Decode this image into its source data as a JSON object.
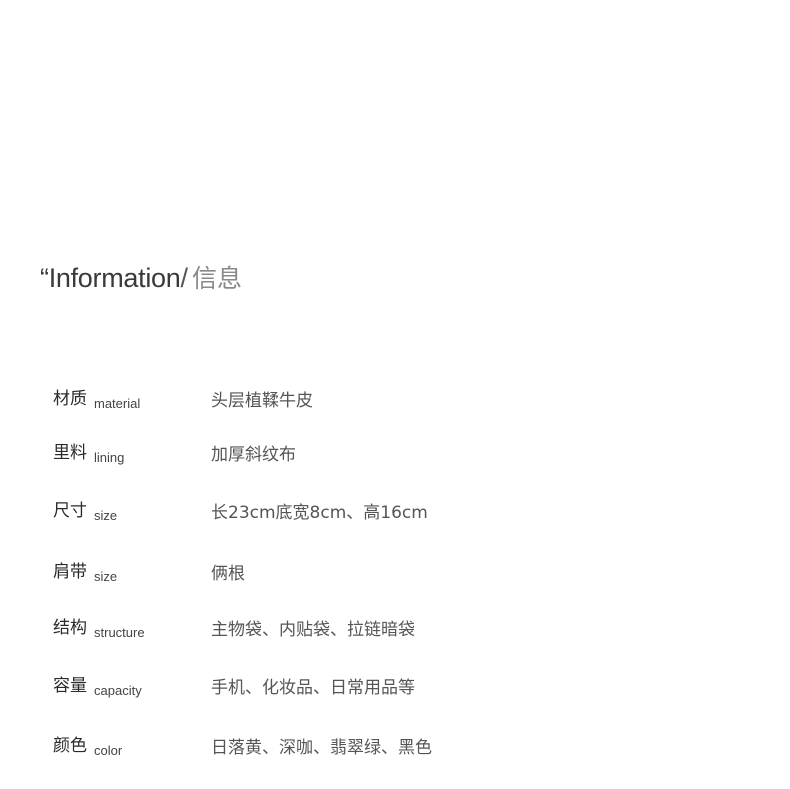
{
  "heading": {
    "english": "“Information",
    "separator": "/",
    "chinese": "信息"
  },
  "specs": [
    {
      "label_cn": "材质",
      "label_en": "material",
      "value": "头层植鞣牛皮"
    },
    {
      "label_cn": "里料",
      "label_en": "lining",
      "value": "加厚斜纹布"
    },
    {
      "label_cn": "尺寸",
      "label_en": "size",
      "value": "长23cm底宽8cm、高16cm"
    },
    {
      "label_cn": "肩带",
      "label_en": "size",
      "value": "俩根"
    },
    {
      "label_cn": "结构",
      "label_en": "structure",
      "value": "主物袋、内贴袋、拉链暗袋"
    },
    {
      "label_cn": "容量",
      "label_en": "capacity",
      "value": "手机、化妆品、日常用品等"
    },
    {
      "label_cn": "颜色",
      "label_en": "color",
      "value": "日落黄、深咖、翡翠绿、黑色"
    }
  ]
}
